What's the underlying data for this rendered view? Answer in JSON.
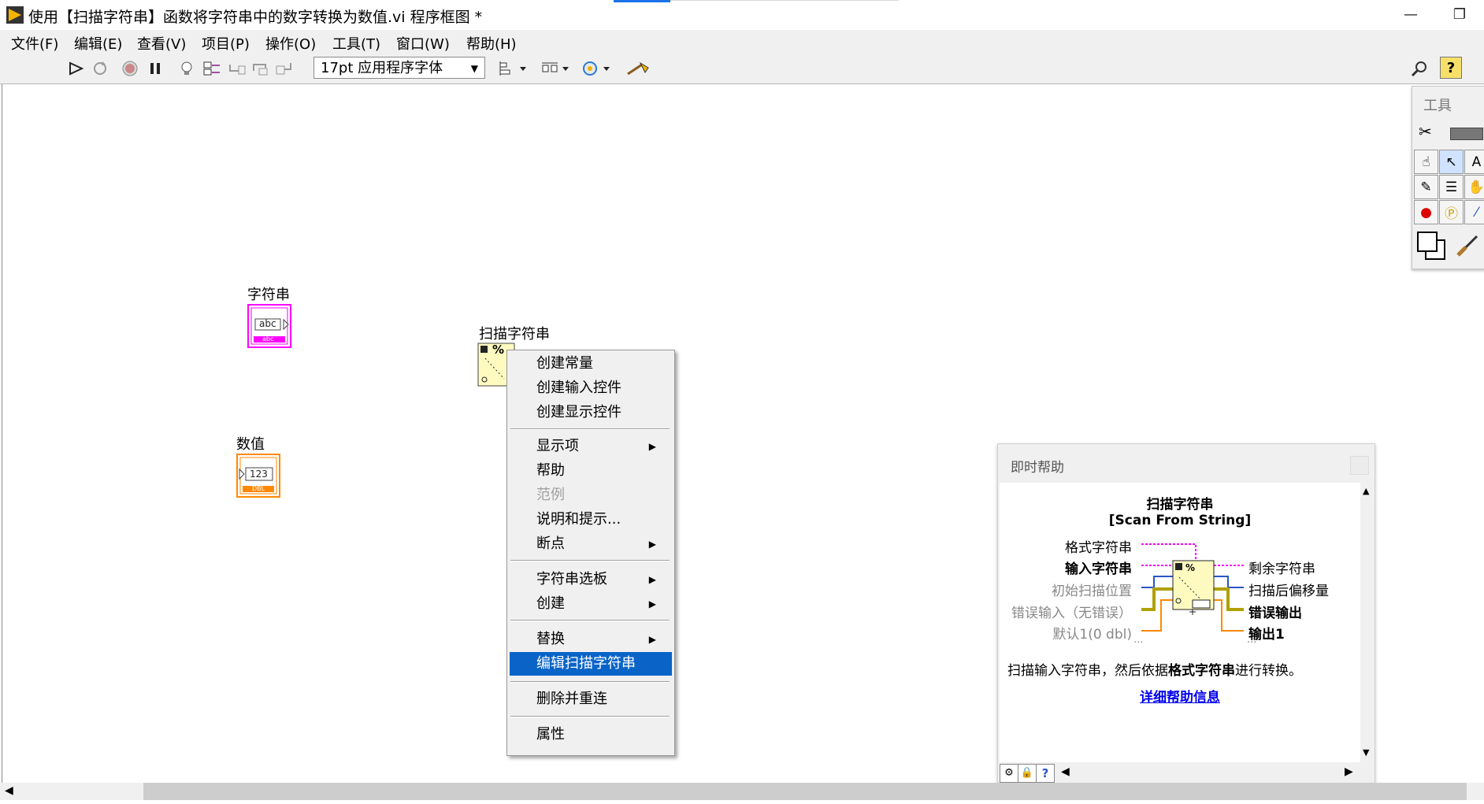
{
  "window": {
    "title": "使用【扫描字符串】函数将字符串中的数字转换为数值.vi 程序框图 *",
    "min_label": "—",
    "restore_label": "❐",
    "close_label": "✕"
  },
  "menubar": [
    "文件(F)",
    "编辑(E)",
    "查看(V)",
    "项目(P)",
    "操作(O)",
    "工具(T)",
    "窗口(W)",
    "帮助(H)"
  ],
  "toolbar": {
    "font": "17pt 应用程序字体",
    "help_label": "?"
  },
  "diagram": {
    "string_control": {
      "label": "字符串",
      "inner": "abc",
      "type": "abc"
    },
    "numeric_indicator": {
      "label": "数值",
      "inner": "123",
      "type": "DBL"
    },
    "scan_function": {
      "label": "扫描字符串",
      "glyph": "%"
    }
  },
  "context_menu": {
    "items": [
      {
        "label": "创建常量"
      },
      {
        "label": "创建输入控件"
      },
      {
        "label": "创建显示控件"
      },
      {
        "label": "显示项",
        "submenu": "▶"
      },
      {
        "label": "帮助"
      },
      {
        "label": "范例"
      },
      {
        "label": "说明和提示..."
      },
      {
        "label": "断点",
        "submenu": "▶"
      },
      {
        "label": "字符串选板",
        "submenu": "▶"
      },
      {
        "label": "创建",
        "submenu": "▶"
      },
      {
        "label": "替换",
        "submenu": "▶"
      },
      {
        "label": "编辑扫描字符串"
      },
      {
        "label": "删除并重连"
      },
      {
        "label": "属性"
      }
    ]
  },
  "tools_palette": {
    "title": "工具"
  },
  "context_help": {
    "window_title": "即时帮助",
    "function_name": "扫描字符串",
    "function_name_en": "[Scan From String]",
    "inputs": [
      "格式字符串",
      "输入字符串",
      "初始扫描位置",
      "错误输入（无错误）",
      "默认1(0 dbl)",
      "..."
    ],
    "outputs": [
      "剩余字符串",
      "扫描后偏移量",
      "错误输出",
      "输出1",
      "..."
    ],
    "desc_pre": "扫描输入字符串，然后依据",
    "desc_bold": "格式字符串",
    "desc_post": "进行转换。",
    "link": "详细帮助信息"
  },
  "colors": {
    "string_pink": "#ff00ff",
    "numeric_orange": "#ff8800",
    "function_bg": "#fffbc0",
    "highlight": "#0a64c8",
    "link": "#0000ee"
  }
}
